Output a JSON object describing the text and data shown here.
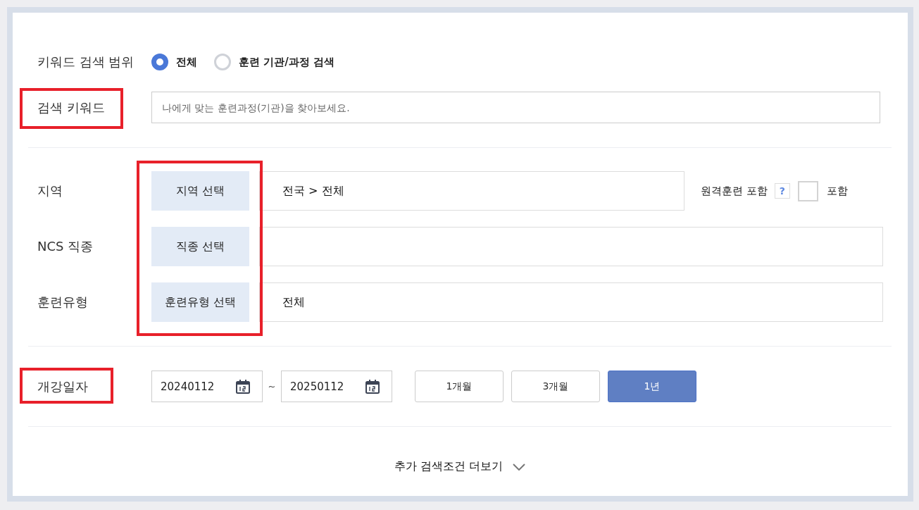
{
  "keyword_scope": {
    "label": "키워드 검색 범위",
    "options": [
      {
        "label": "전체",
        "selected": true
      },
      {
        "label": "훈련 기관/과정 검색",
        "selected": false
      }
    ]
  },
  "search_keyword": {
    "label": "검색 키워드",
    "placeholder": "나에게 맞는 훈련과정(기관)을 찾아보세요."
  },
  "filters": [
    {
      "kind": "region",
      "label": "지역",
      "button": "지역 선택",
      "value": "전국 > 전체"
    },
    {
      "kind": "plain",
      "label": "NCS 직종",
      "button": "직종 선택"
    },
    {
      "kind": "plain",
      "label": "훈련유형",
      "button": "훈련유형 선택",
      "value": "전체"
    }
  ],
  "remote": {
    "label": "원격훈련 포함",
    "help": "?",
    "checkbox_label": "포함",
    "checked": false
  },
  "start_date": {
    "label": "개강일자",
    "from": "20240112",
    "separator": "~",
    "to": "20250112",
    "periods": [
      {
        "label": "1개월",
        "selected": false
      },
      {
        "label": "3개월",
        "selected": false
      },
      {
        "label": "1년",
        "selected": true
      }
    ]
  },
  "more": "추가 검색조건 더보기"
}
